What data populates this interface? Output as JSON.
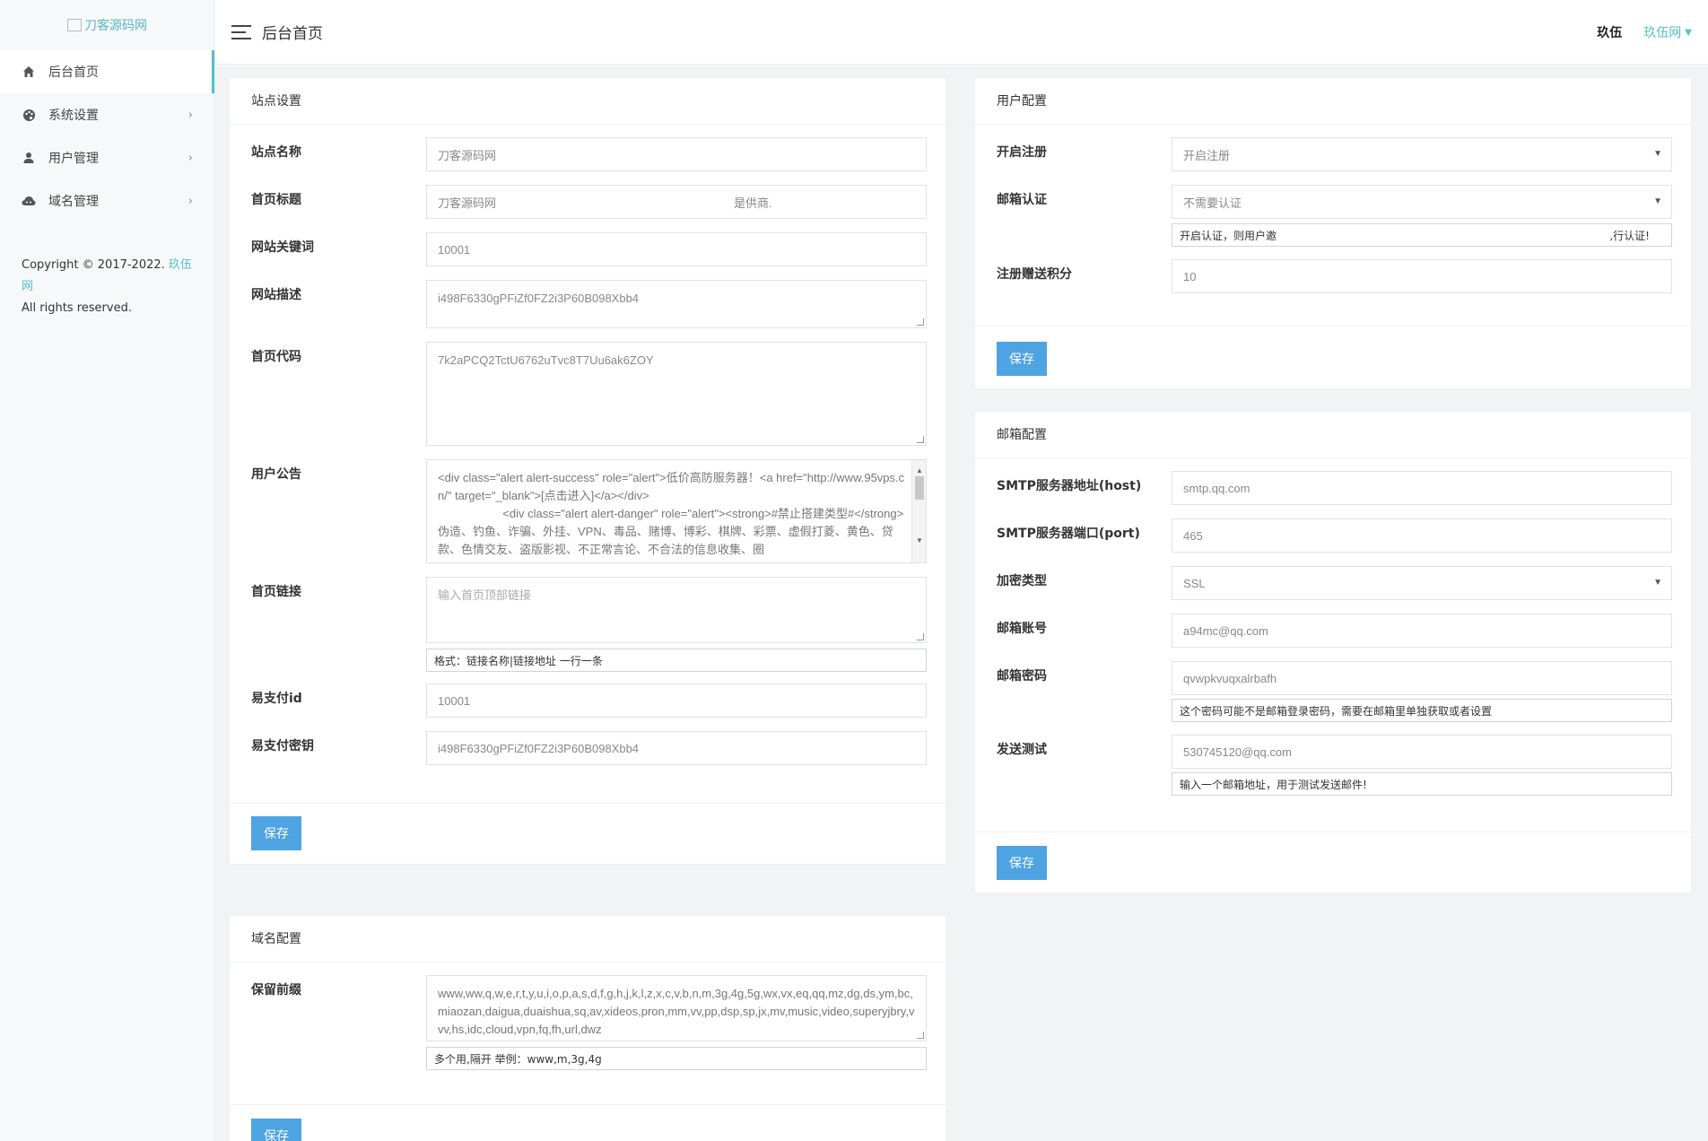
{
  "sidebar": {
    "logo_alt": "刀客源码网",
    "items": [
      {
        "label": "后台首页"
      },
      {
        "label": "系统设置"
      },
      {
        "label": "用户管理"
      },
      {
        "label": "域名管理"
      }
    ],
    "copyright_prefix": "Copyright © 2017-2022.",
    "copyright_brand": "玖伍网",
    "copyright_rights": "All rights reserved."
  },
  "topbar": {
    "title": "后台首页",
    "user_short": "玖伍",
    "user_site": "玖伍网"
  },
  "site": {
    "title": "站点设置",
    "name_label": "站点名称",
    "name_value": "刀客源码网",
    "home_title_label": "首页标题",
    "home_title_value": "刀客源码网",
    "home_title_suffix": "是供商.",
    "keywords_label": "网站关键词",
    "keywords_value": "10001",
    "desc_label": "网站描述",
    "desc_value": "i498F6330gPFiZf0FZ2i3P60B098Xbb4",
    "code_label": "首页代码",
    "code_value": "7k2aPCQ2TctU6762uTvc8T7Uu6ak6ZOY",
    "notice_label": "用户公告",
    "notice_value": "<div class=\"alert alert-success\" role=\"alert\">低价高防服务器！<a href=\"http://www.95vps.cn/\" target=\"_blank\">[点击进入]</a></div>\n                    <div class=\"alert alert-danger\" role=\"alert\"><strong>#禁止搭建类型#</strong> 伪造、钓鱼、诈骗、外挂、VPN、毒品、赌博、博彩、棋牌、彩票、虚假打菱、黄色、贷款、色情交友、盗版影视、不正常言论、不合法的信息收集、圈",
    "link_label": "首页链接",
    "link_placeholder": "输入首页顶部链接",
    "link_hint": "格式：链接名称|链接地址 一行一条",
    "pay_id_label": "易支付id",
    "pay_id_value": "10001",
    "pay_key_label": "易支付密钥",
    "pay_key_value": "i498F6330gPFiZf0FZ2i3P60B098Xbb4",
    "save_label": "保存"
  },
  "domain": {
    "title": "域名配置",
    "reserve_label": "保留前缀",
    "reserve_value": "www,ww,q,w,e,r,t,y,u,i,o,p,a,s,d,f,g,h,j,k,l,z,x,c,v,b,n,m,3g,4g,5g,wx,vx,eq,qq,mz,dg,ds,ym,bc,miaozan,daigua,duaishua,sq,av,xideos,pron,mm,vv,pp,dsp,sp,jx,mv,music,video,superyjbry,vvv,hs,idc,cloud,vpn,fq,fh,url,dwz",
    "reserve_hint": "多个用,隔开 举例：www,m,3g,4g",
    "save_label": "保存"
  },
  "user": {
    "title": "用户配置",
    "reg_label": "开启注册",
    "reg_value": "开启注册",
    "mail_verify_label": "邮箱认证",
    "mail_verify_value": "不需要认证",
    "mail_verify_hint": "开启认证，则用户邀",
    "mail_verify_hint_end": ",行认证!",
    "bonus_label": "注册赠送积分",
    "bonus_value": "10",
    "save_label": "保存"
  },
  "mail": {
    "title": "邮箱配置",
    "host_label": "SMTP服务器地址(host)",
    "host_value": "smtp.qq.com",
    "port_label": "SMTP服务器端口(port)",
    "port_value": "465",
    "enc_label": "加密类型",
    "enc_value": "SSL",
    "account_label": "邮箱账号",
    "account_value": "a94mc@qq.com",
    "pwd_label": "邮箱密码",
    "pwd_value": "qvwpkvuqxalrbafh",
    "pwd_hint": "这个密码可能不是邮箱登录密码，需要在邮箱里单独获取或者设置",
    "test_label": "发送测试",
    "test_value": "530745120@qq.com",
    "test_hint": "输入一个邮箱地址，用于测试发送邮件!",
    "save_label": "保存"
  }
}
